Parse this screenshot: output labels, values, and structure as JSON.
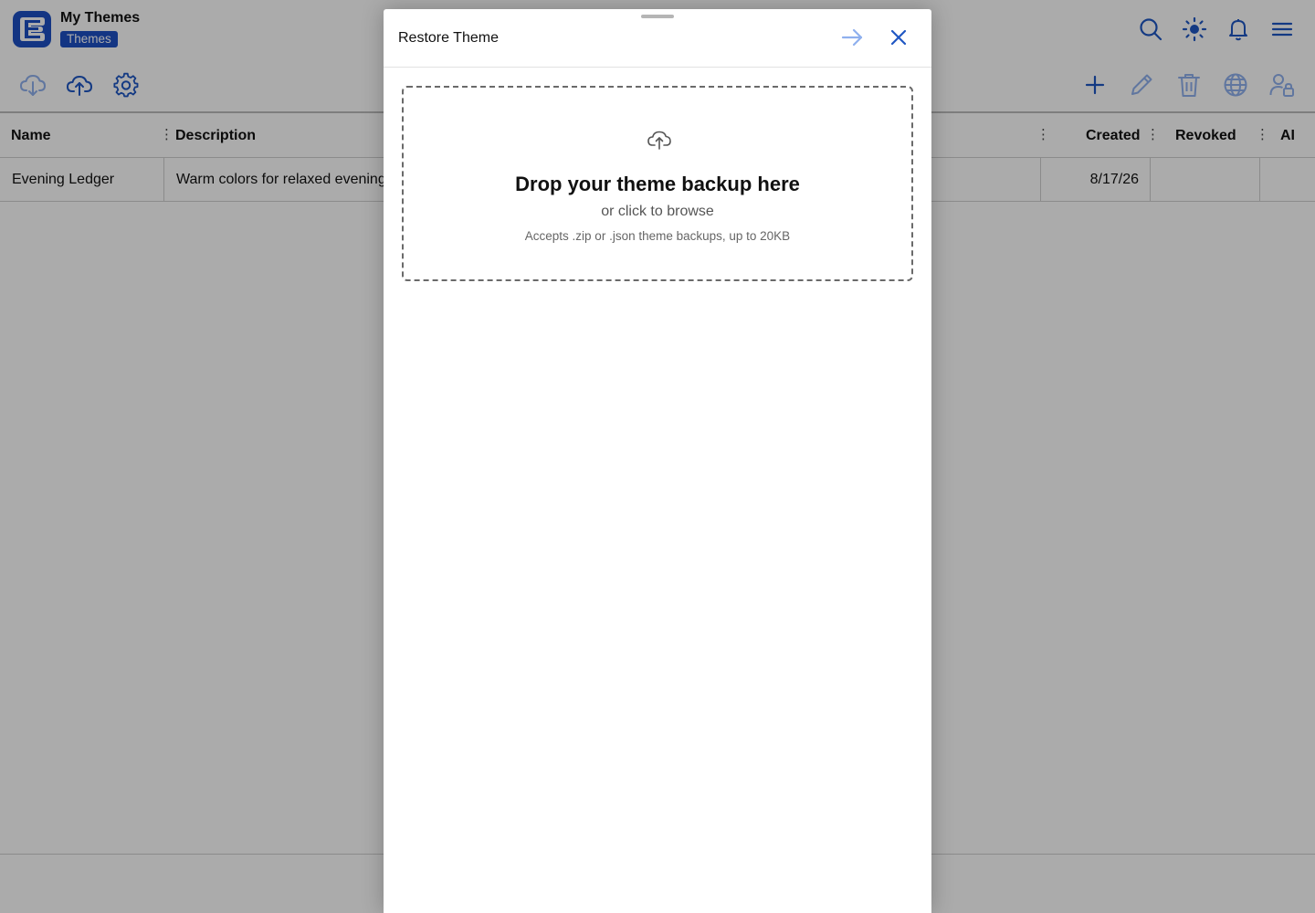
{
  "app": {
    "title": "My Themes",
    "badge": "Themes"
  },
  "header_icons": [
    "search-icon",
    "sun-icon",
    "bell-icon",
    "menu-icon"
  ],
  "toolbar": {
    "left_icons": [
      "cloud-download-icon",
      "cloud-upload-icon",
      "gear-icon"
    ],
    "right_icons": [
      "plus-icon",
      "pencil-icon",
      "trash-icon",
      "globe-icon",
      "user-lock-icon"
    ]
  },
  "table": {
    "columns": {
      "name": "Name",
      "description": "Description",
      "created": "Created",
      "revoked": "Revoked",
      "ai": "AI"
    },
    "column_menu_glyph": "⋮",
    "rows": [
      {
        "name": "Evening Ledger",
        "description": "Warm colors for relaxed evening",
        "created": "8/17/26",
        "revoked": ""
      }
    ]
  },
  "modal": {
    "title": "Restore Theme",
    "dropzone": {
      "title": "Drop your theme backup here",
      "subtitle": "or click to browse",
      "hint": "Accepts .zip or .json theme backups, up to 20KB"
    }
  },
  "colors": {
    "accent": "#1d4fc4",
    "icon_blue": "#1f57c3",
    "next_arrow_disabled": "#8fb0ee",
    "overlay": "rgba(0,0,0,0.33)"
  }
}
